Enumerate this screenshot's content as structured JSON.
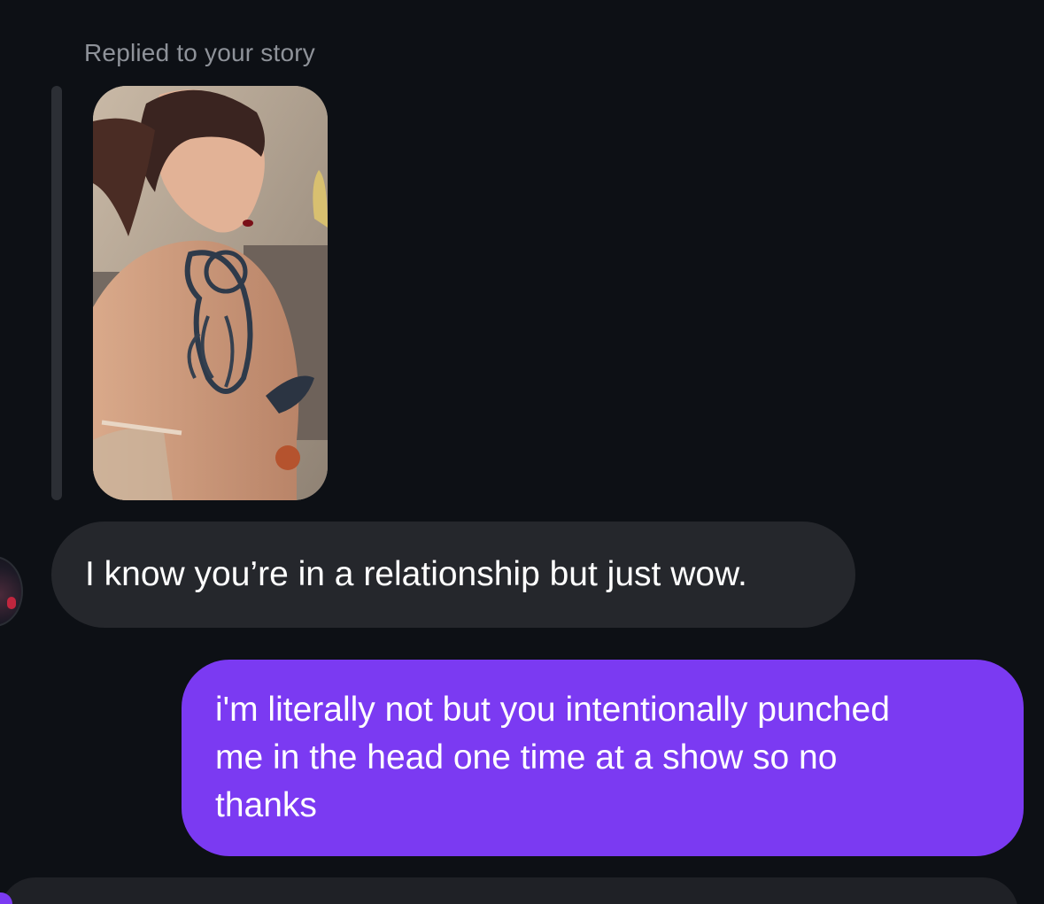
{
  "conversation": {
    "reply_context": "Replied to your story",
    "messages": [
      {
        "direction": "incoming",
        "text": "I know you’re in a relationship but just wow."
      },
      {
        "direction": "outgoing",
        "lines": [
          "i'm literally not but you intentionally punched",
          "me in the head one time at a show so no",
          "thanks"
        ]
      }
    ]
  },
  "colors": {
    "background": "#0d1015",
    "incoming_bubble": "#25272c",
    "outgoing_bubble": "#7b3af2",
    "muted_text": "#8e9299"
  }
}
